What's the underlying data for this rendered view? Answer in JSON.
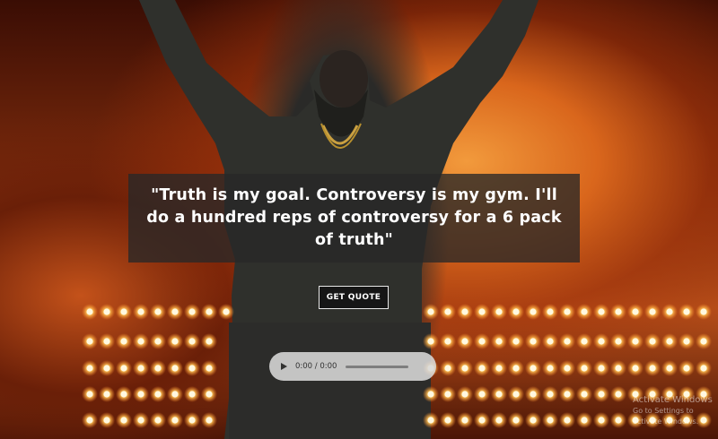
{
  "quote": {
    "text": "\"Truth is my goal. Controversy is my gym. I'll do a hundred reps of controversy for a 6 pack of truth\""
  },
  "button": {
    "label": "GET QUOTE"
  },
  "audio": {
    "time": "0:00 / 0:00",
    "progress": 0
  },
  "watermark": {
    "title": "Activate Windows",
    "subtitle": "Go to Settings to activate Windows."
  },
  "colors": {
    "overlay": "#282828",
    "button_bg": "#161616",
    "stage_light": "#ffd27a"
  }
}
